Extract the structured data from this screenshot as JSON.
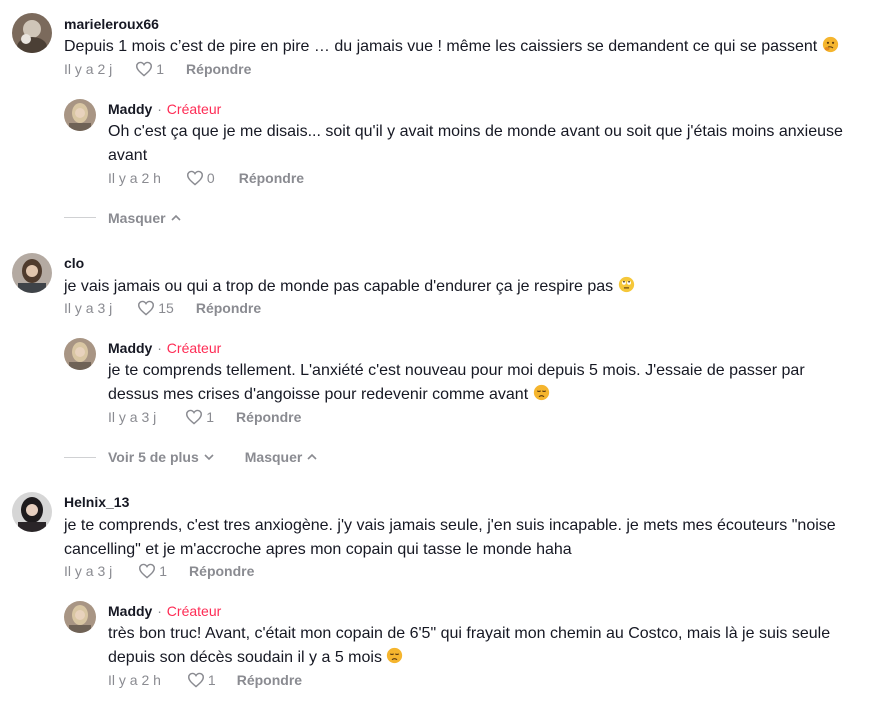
{
  "comments": [
    {
      "username": "marieleroux66",
      "text": "Depuis 1 mois c’est de pire en pire … du jamais vue ! même les caissiers se demandent ce qui se passent",
      "emoji": "thinking-face",
      "time": "Il y a 2 j",
      "likes": "1",
      "reply_label": "Répondre",
      "reply": {
        "username": "Maddy",
        "sep": "·",
        "role": "Créateur",
        "text": "Oh c'est ça que je me disais... soit qu'il y avait moins de monde avant ou soit que j'étais moins anxieuse avant",
        "time": "Il y a 2 h",
        "likes": "0",
        "reply_label": "Répondre"
      },
      "hide_label": "Masquer"
    },
    {
      "username": "clo",
      "text": "je vais jamais ou qui a trop de monde pas capable d'endurer ça je respire pas",
      "emoji": "eye-roll-face",
      "time": "Il y a 3 j",
      "likes": "15",
      "reply_label": "Répondre",
      "reply": {
        "username": "Maddy",
        "sep": "·",
        "role": "Créateur",
        "text": "je te comprends tellement. L'anxiété c'est nouveau pour moi depuis 5 mois. J'essaie de passer par dessus mes crises d'angoisse pour redevenir comme avant",
        "time": "Il y a 3 j",
        "likes": "1",
        "reply_label": "Répondre"
      },
      "more_label": "Voir 5 de plus",
      "hide_label": "Masquer"
    },
    {
      "username": "Helnix_13",
      "text": "je te comprends, c'est tres anxiogène. j'y vais jamais seule, j'en suis incapable. je mets mes écouteurs \"noise cancelling\" et je m'accroche apres mon copain qui tasse le monde haha",
      "time": "Il y a 3 j",
      "likes": "1",
      "reply_label": "Répondre",
      "reply": {
        "username": "Maddy",
        "sep": "·",
        "role": "Créateur",
        "text": "très bon truc! Avant, c'était mon copain de 6'5\" qui frayait mon chemin au Costco, mais là je suis seule depuis son décès soudain il y a 5 mois",
        "time": "Il y a 2 h",
        "likes": "1",
        "reply_label": "Répondre"
      }
    }
  ],
  "colors": {
    "text": "#161823",
    "muted": "#8a8b91",
    "creator": "#fe2c55"
  }
}
